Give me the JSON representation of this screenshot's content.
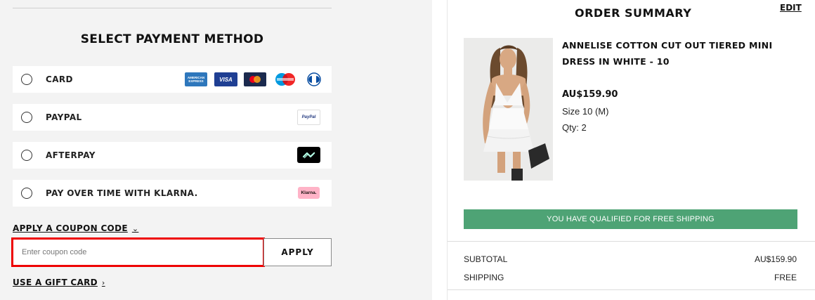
{
  "payment": {
    "title": "SELECT PAYMENT METHOD",
    "methods": [
      {
        "label": "CARD",
        "logos": [
          "amex",
          "visa",
          "mastercard",
          "maestro",
          "diners"
        ]
      },
      {
        "label": "PAYPAL",
        "logos": [
          "paypal"
        ]
      },
      {
        "label": "AFTERPAY",
        "logos": [
          "afterpay"
        ]
      },
      {
        "label": "PAY OVER TIME WITH KLARNA.",
        "logos": [
          "klarna"
        ]
      }
    ],
    "logo_text": {
      "amex": "AMERICAN EXPRESS",
      "visa": "VISA",
      "paypal": "PayPal",
      "klarna": "Klarna."
    },
    "coupon_link": "APPLY A COUPON CODE",
    "coupon_placeholder": "Enter coupon code",
    "apply_label": "APPLY",
    "gift_link": "USE A GIFT CARD"
  },
  "summary": {
    "title": "ORDER SUMMARY",
    "edit_label": "EDIT",
    "product": {
      "name": "ANNELISE COTTON CUT OUT TIERED MINI DRESS IN WHITE - 10",
      "price": "AU$159.90",
      "size": "Size 10 (M)",
      "qty": "Qty: 2"
    },
    "shipping_banner": "YOU HAVE QUALIFIED FOR FREE SHIPPING",
    "totals": [
      {
        "label": "SUBTOTAL",
        "value": "AU$159.90"
      },
      {
        "label": "SHIPPING",
        "value": "FREE"
      }
    ]
  },
  "colors": {
    "panel_bg": "#f3f3f3",
    "banner": "#4ea375",
    "highlight": "#e00000"
  }
}
